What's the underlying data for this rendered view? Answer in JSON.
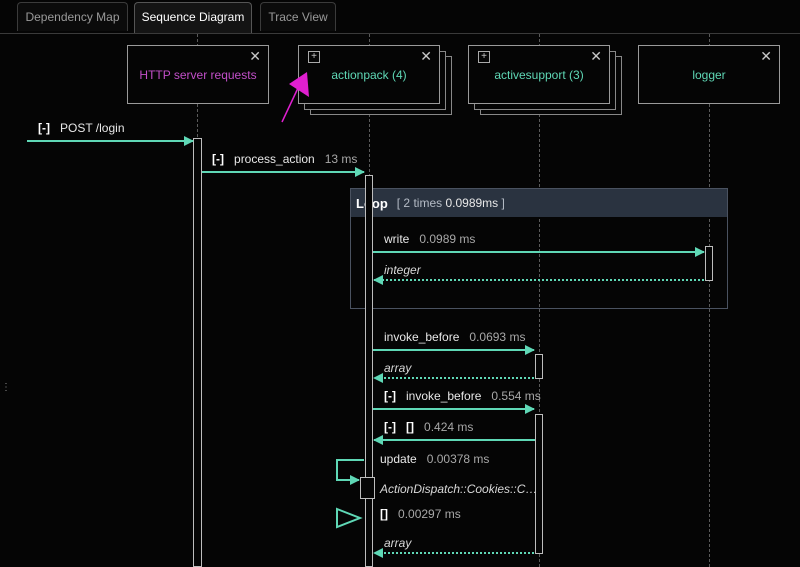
{
  "tabs": [
    {
      "label": "Dependency Map"
    },
    {
      "label": "Sequence Diagram"
    },
    {
      "label": "Trace View"
    }
  ],
  "participants": [
    {
      "label": "HTTP server requests",
      "color": "#c24fc9"
    },
    {
      "label": "actionpack (4)",
      "color": "#5fd8b6"
    },
    {
      "label": "activesupport (3)",
      "color": "#5fd8b6"
    },
    {
      "label": "logger",
      "color": "#5fd8b6"
    }
  ],
  "icons": {
    "close": "✕",
    "expand": "+",
    "handle": "⋮"
  },
  "colors": {
    "arrow": "#5fd8b6",
    "pointer": "#e01fd0",
    "loop_header": "#2a3340"
  },
  "messages": {
    "post_login": {
      "bracket": "[-]",
      "name": "POST /login"
    },
    "process_action": {
      "bracket": "[-]",
      "name": "process_action",
      "duration": "13 ms"
    },
    "loop": {
      "title": "Loop",
      "detail_prefix": "[ 2 times",
      "detail_value": "0.0989ms",
      "detail_suffix": "]"
    },
    "write": {
      "name": "write",
      "duration": "0.0989 ms"
    },
    "write_return": {
      "name": "integer"
    },
    "invoke_before_1": {
      "name": "invoke_before",
      "duration": "0.0693 ms"
    },
    "invoke_before_1_return": {
      "name": "array"
    },
    "invoke_before_2": {
      "bracket": "[-]",
      "name": "invoke_before",
      "duration": "0.554 ms"
    },
    "nested_call": {
      "bracket": "[-]",
      "name": "[]",
      "duration": "0.424 ms"
    },
    "update": {
      "name": "update",
      "duration": "0.00378 ms"
    },
    "update_return": {
      "name": "ActionDispatch::Cookies::C…"
    },
    "bracket_call": {
      "name": "[]",
      "duration": "0.00297 ms"
    },
    "final_return": {
      "name": "array"
    }
  }
}
